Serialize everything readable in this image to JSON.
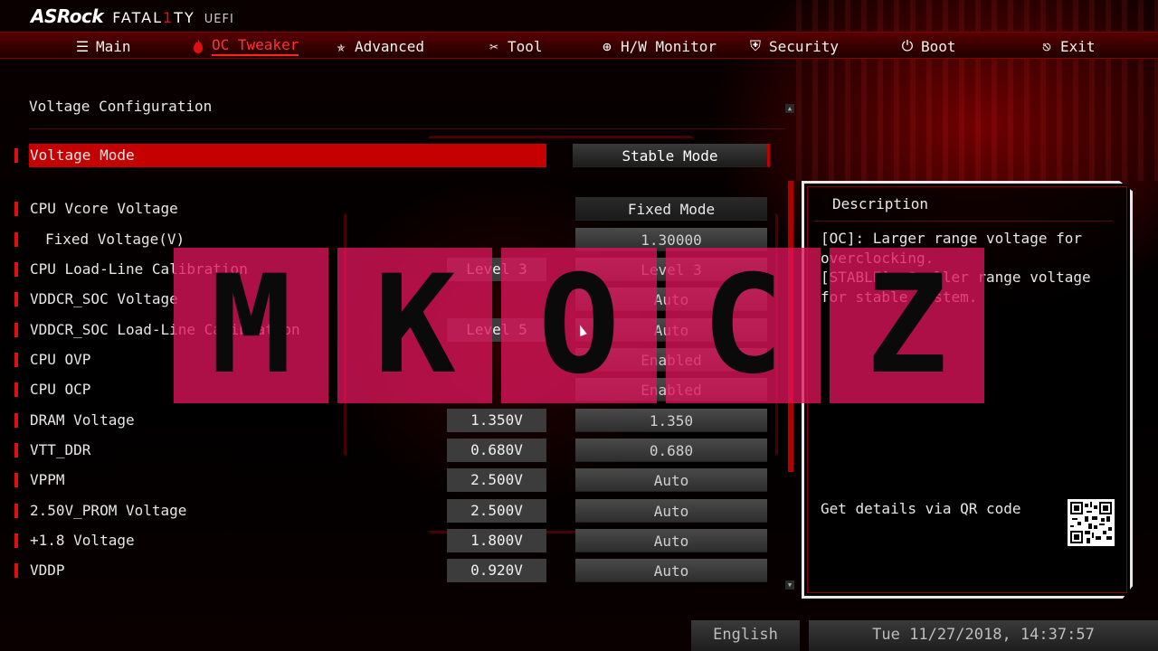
{
  "brand": {
    "name": "ASRock",
    "series_a": "FATAL",
    "series_b": "1",
    "series_c": "TY",
    "suffix": "UEFI"
  },
  "nav": {
    "items": [
      {
        "label": "Main",
        "icon": "list-icon"
      },
      {
        "label": "OC Tweaker",
        "icon": "flame-icon",
        "active": true
      },
      {
        "label": "Advanced",
        "icon": "star-icon"
      },
      {
        "label": "Tool",
        "icon": "tools-icon"
      },
      {
        "label": "H/W Monitor",
        "icon": "monitor-icon"
      },
      {
        "label": "Security",
        "icon": "shield-icon"
      },
      {
        "label": "Boot",
        "icon": "power-icon"
      },
      {
        "label": "Exit",
        "icon": "exit-icon"
      }
    ]
  },
  "main": {
    "section_title": "Voltage Configuration",
    "rows": [
      {
        "label": "Voltage Mode",
        "current": "",
        "value": "Stable Mode"
      },
      {
        "label": "CPU Vcore Voltage",
        "current": "",
        "value": "Fixed Mode"
      },
      {
        "label": "Fixed Voltage(V)",
        "current": "",
        "value": "1.30000"
      },
      {
        "label": "CPU Load-Line Calibration",
        "current": "Level 3",
        "value": "Level 3"
      },
      {
        "label": "VDDCR_SOC Voltage",
        "current": "",
        "value": "Auto"
      },
      {
        "label": "VDDCR_SOC Load-Line Calibration",
        "current": "Level 5",
        "value": "Auto"
      },
      {
        "label": "CPU OVP",
        "current": "",
        "value": "Enabled"
      },
      {
        "label": "CPU OCP",
        "current": "",
        "value": "Enabled"
      },
      {
        "label": "DRAM Voltage",
        "current": "1.350V",
        "value": "1.350"
      },
      {
        "label": "VTT_DDR",
        "current": "0.680V",
        "value": "0.680"
      },
      {
        "label": "VPPM",
        "current": "2.500V",
        "value": "Auto"
      },
      {
        "label": "2.50V_PROM Voltage",
        "current": "2.500V",
        "value": "Auto"
      },
      {
        "label": "+1.8 Voltage",
        "current": "1.800V",
        "value": "Auto"
      },
      {
        "label": "VDDP",
        "current": "0.920V",
        "value": "Auto"
      }
    ]
  },
  "description": {
    "title": "Description",
    "line1": "[OC]: Larger range voltage for overclocking.",
    "line2": "[STABLE]: Smaller range voltage for stable system.",
    "qr_label": "Get details via QR code"
  },
  "watermark": [
    "M",
    "K",
    "O",
    "C",
    "Z"
  ],
  "footer": {
    "language": "English",
    "datetime": "Tue 11/27/2018, 14:37:57"
  },
  "colors": {
    "accent": "#c50000",
    "watermark": "#dc145a"
  }
}
